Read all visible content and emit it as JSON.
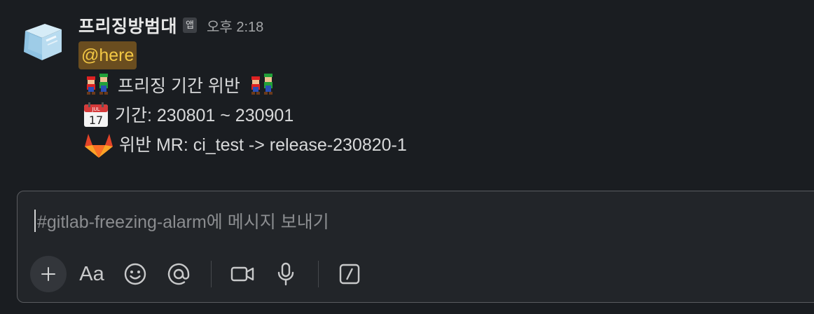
{
  "message": {
    "sender": "프리징방범대",
    "app_badge": "앱",
    "timestamp": "오후 2:18",
    "mention": "@here",
    "lines": [
      {
        "icon": "mario-luigi-icon",
        "text": "프리징 기간 위반",
        "trailing_icon": "mario-luigi-icon"
      },
      {
        "icon": "calendar-icon",
        "text": "기간: 230801 ~ 230901"
      },
      {
        "icon": "gitlab-icon",
        "text": "위반 MR: ci_test -> release-230820-1"
      }
    ]
  },
  "composer": {
    "placeholder": "#gitlab-freezing-alarm에 메시지 보내기",
    "toolbar": {
      "plus": "plus-icon",
      "format_label": "Aa",
      "emoji": "smiley-icon",
      "mention": "at-icon",
      "video": "video-icon",
      "audio": "microphone-icon",
      "shortcut": "slash-icon"
    }
  },
  "colors": {
    "background": "#1a1d21",
    "mention_bg": "#6a4d1f",
    "mention_text": "#f2c744",
    "composer_border": "#5a5c60"
  }
}
